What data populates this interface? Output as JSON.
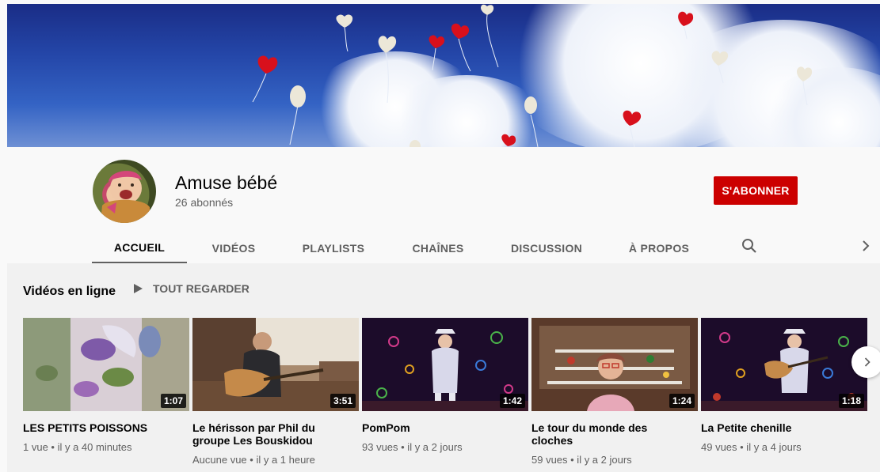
{
  "channel": {
    "name": "Amuse bébé",
    "subscribers": "26 abonnés",
    "subscribe_label": "S'ABONNER"
  },
  "tabs": [
    "ACCUEIL",
    "VIDÉOS",
    "PLAYLISTS",
    "CHAÎNES",
    "DISCUSSION",
    "À PROPOS"
  ],
  "active_tab": "ACCUEIL",
  "shelf": {
    "title": "Vidéos en ligne",
    "play_all": "TOUT REGARDER"
  },
  "videos": [
    {
      "title": "LES PETITS POISSONS",
      "meta": "1 vue • il y a 40 minutes",
      "duration": "1:07"
    },
    {
      "title": "Le hérisson par Phil du groupe Les Bouskidou",
      "meta": "Aucune vue • il y a 1 heure",
      "duration": "3:51"
    },
    {
      "title": "PomPom",
      "meta": "93 vues • il y a 2 jours",
      "duration": "1:42"
    },
    {
      "title": "Le tour du monde des cloches",
      "meta": "59 vues • il y a 2 jours",
      "duration": "1:24"
    },
    {
      "title": "La Petite chenille",
      "meta": "49 vues • il y a 4 jours",
      "duration": "1:18"
    }
  ],
  "colors": {
    "subscribe": "#cc0000",
    "banner_sky": "#2446a8",
    "balloon_red": "#d8101c",
    "balloon_white": "#e8e4d6"
  },
  "icons": [
    "search-icon",
    "chevron-right-icon",
    "play-icon"
  ]
}
